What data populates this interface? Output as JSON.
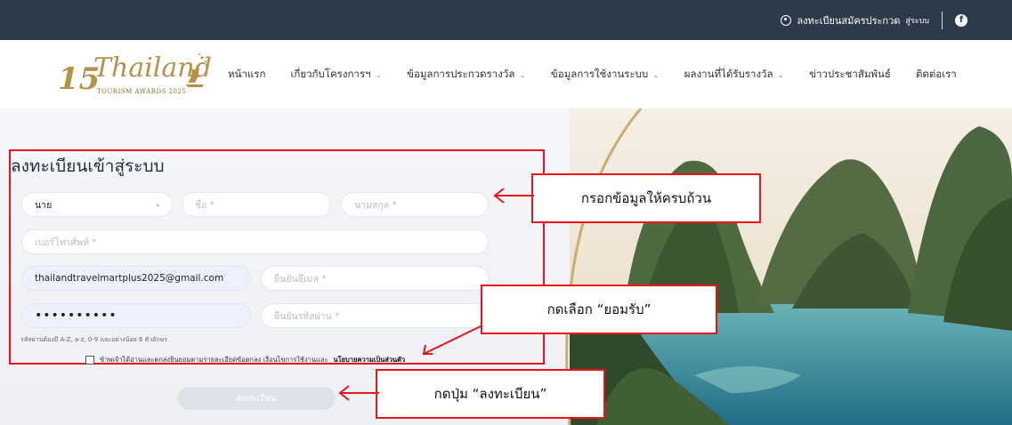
{
  "topbar": {
    "register_link": "ลงทะเบียนสมัครประกวด",
    "login_link": "สู่ระบบ",
    "facebook_icon": "facebook-icon",
    "background": "#2d3a4b"
  },
  "logo": {
    "number": "15",
    "brand": "Thailand",
    "sub": "TOURISM AWARDS 2025"
  },
  "nav": [
    {
      "label": "หน้าแรก",
      "caret": ""
    },
    {
      "label": "เกี่ยวกับโครงการฯ",
      "caret": "⌄"
    },
    {
      "label": "ข้อมูลการประกวดรางวัล",
      "caret": "⌄"
    },
    {
      "label": "ข้อมูลการใช้งานระบบ",
      "caret": "⌄"
    },
    {
      "label": "ผลงานที่ได้รับรางวัล",
      "caret": "⌄"
    },
    {
      "label": "ข่าวประชาสัมพันธ์",
      "caret": ""
    },
    {
      "label": "ติดต่อเรา",
      "caret": ""
    }
  ],
  "form": {
    "title": "ลงทะเบียนเข้าสู่ระบบ",
    "title_select_value": "นาย",
    "first_name_placeholder": "ชื่อ *",
    "last_name_placeholder": "นามสกุล *",
    "phone_placeholder": "เบอร์โทรศัพท์ *",
    "email_value": "thailandtravelmartplus2025@gmail.com",
    "email_confirm_placeholder": "ยืนยันอีเมล *",
    "password_value": "••••••••••",
    "password_confirm_placeholder": "ยืนยันรหัสผ่าน *",
    "password_hint": "รหัสผ่านต้องมี A-Z, a-z, 0-9 และอย่างน้อย 6 ตัวอักษร",
    "consent_text": "ข้าพเจ้าได้อ่านและตกลงยินยอมตามรายละเอียดข้อตกลง เงื่อนไขการใช้งานและ",
    "consent_link": "นโยบายความเป็นส่วนตัว",
    "submit_label": "ลงทะเบียน"
  },
  "callouts": {
    "fill_info": "กรอกข้อมูลให้ครบถ้วน",
    "accept": "กดเลือก “ยอมรับ”",
    "register": "กดปุ่ม “ลงทะเบียน”"
  },
  "colors": {
    "annotation_red": "#e8151b",
    "gold": "#b5914a",
    "navy": "#1f2b44"
  }
}
